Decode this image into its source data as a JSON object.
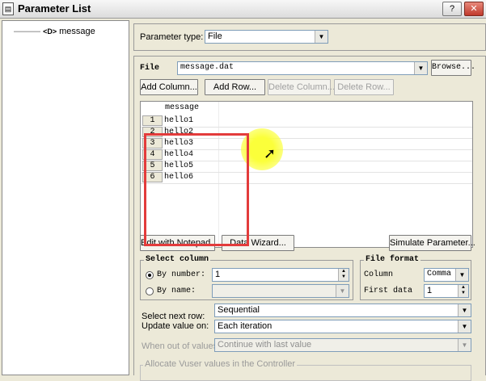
{
  "window": {
    "title": "Parameter List",
    "help_btn": "?",
    "close_btn": "✕"
  },
  "tree": {
    "node_tag": "<D>",
    "node_label": "message"
  },
  "param_type": {
    "label": "Parameter type:",
    "value": "File"
  },
  "file": {
    "label": "File",
    "value": "message.dat",
    "browse": "Browse..."
  },
  "buttons": {
    "add_column": "Add Column...",
    "add_row": "Add Row...",
    "delete_column": "Delete Column...",
    "delete_row": "Delete Row...",
    "edit_notepad": "Edit with Notepad...",
    "data_wizard": "Data Wizard...",
    "simulate": "Simulate Parameter..."
  },
  "table": {
    "column_header": "message",
    "rows": [
      {
        "num": "1",
        "value": "hello1"
      },
      {
        "num": "2",
        "value": "hello2"
      },
      {
        "num": "3",
        "value": "hello3"
      },
      {
        "num": "4",
        "value": "hello4"
      },
      {
        "num": "5",
        "value": "hello5"
      },
      {
        "num": "6",
        "value": "hello6"
      }
    ]
  },
  "select_column": {
    "title": "Select column",
    "by_number_label": "By number:",
    "by_number_value": "1",
    "by_name_label": "By name:"
  },
  "file_format": {
    "title": "File format",
    "column_label": "Column",
    "column_value": "Comma",
    "first_data_label": "First data",
    "first_data_value": "1"
  },
  "next_row": {
    "label": "Select next row:",
    "value": "Sequential"
  },
  "update_value": {
    "label": "Update value on:",
    "value": "Each iteration"
  },
  "out_of_values": {
    "label": "When out of values:",
    "value": "Continue with last value"
  },
  "allocate": {
    "label": "Allocate Vuser values in the Controller"
  },
  "colors": {
    "highlight_box": "#e33b3b",
    "cursor_highlight": "#fbff3a"
  }
}
